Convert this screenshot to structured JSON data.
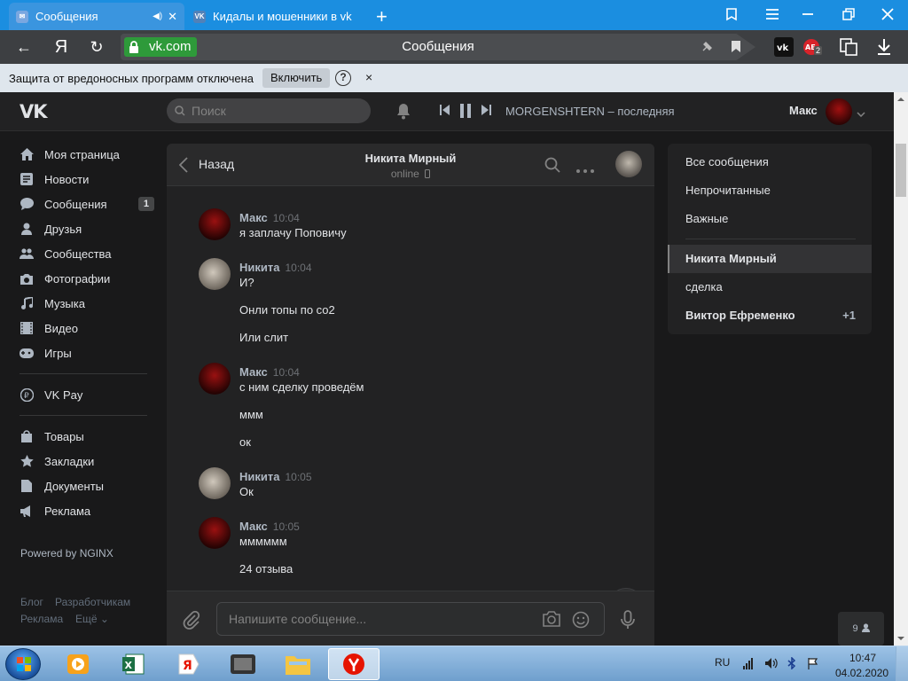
{
  "browser": {
    "tabs": [
      {
        "title": "Сообщения",
        "active": true
      },
      {
        "title": "Кидалы и мошенники в vk",
        "active": false
      }
    ],
    "new_tab": "+",
    "address": {
      "domain": "vk.com",
      "page_title": "Сообщения"
    },
    "nav": {
      "back": "←",
      "yandex": "Я",
      "reload": "↻"
    },
    "extensions": [
      "vk-extension-icon",
      "adblock-extension-icon",
      "screenshot-extension-icon",
      "download-icon"
    ],
    "adblock_badge": "2"
  },
  "protection_bar": {
    "message": "Защита от вредоносных программ отключена",
    "enable_button": "Включить",
    "help": "?",
    "close": "×"
  },
  "vk_header": {
    "logo": "VK",
    "search_placeholder": "Поиск",
    "player": {
      "track": "MORGENSHTERN – последняя"
    },
    "user_name": "Макс"
  },
  "left_nav": {
    "items": [
      {
        "label": "Моя страница",
        "icon": "home-icon"
      },
      {
        "label": "Новости",
        "icon": "news-icon"
      },
      {
        "label": "Сообщения",
        "icon": "messages-icon",
        "badge": "1"
      },
      {
        "label": "Друзья",
        "icon": "friends-icon"
      },
      {
        "label": "Сообщества",
        "icon": "communities-icon"
      },
      {
        "label": "Фотографии",
        "icon": "camera-icon"
      },
      {
        "label": "Музыка",
        "icon": "music-icon"
      },
      {
        "label": "Видео",
        "icon": "video-icon"
      },
      {
        "label": "Игры",
        "icon": "games-icon"
      },
      {
        "label": "VK Pay",
        "icon": "vkpay-icon"
      },
      {
        "label": "Товары",
        "icon": "goods-icon"
      },
      {
        "label": "Закладки",
        "icon": "bookmarks-icon"
      },
      {
        "label": "Документы",
        "icon": "documents-icon"
      },
      {
        "label": "Реклама",
        "icon": "ads-icon"
      }
    ],
    "powered": "Powered by NGINX",
    "footer": {
      "blog": "Блог",
      "developers": "Разработчикам",
      "ads": "Реклама",
      "more": "Ещё ⌄"
    }
  },
  "chat": {
    "back_label": "Назад",
    "peer_name": "Никита Мирный",
    "peer_status": "online",
    "messages": [
      {
        "author": "Макс",
        "time": "10:04",
        "lines": [
          "я заплачу Поповичу"
        ]
      },
      {
        "author": "Никита",
        "time": "10:04",
        "lines": [
          "И?",
          "Онли топы по со2",
          "Или слит"
        ]
      },
      {
        "author": "Макс",
        "time": "10:04",
        "lines": [
          "с ним сделку проведём",
          "ммм",
          "ок"
        ]
      },
      {
        "author": "Никита",
        "time": "10:05",
        "lines": [
          "Ок"
        ]
      },
      {
        "author": "Макс",
        "time": "10:05",
        "lines": [
          "мммммм",
          "24 отзыва"
        ]
      }
    ],
    "input_placeholder": "Напишите сообщение..."
  },
  "right_menu": {
    "items": [
      {
        "label": "Все сообщения"
      },
      {
        "label": "Непрочитанные"
      },
      {
        "label": "Важные"
      }
    ],
    "conversations": [
      {
        "label": "Никита Мирный",
        "selected": true
      },
      {
        "label": "сделка"
      },
      {
        "label": "Виктор Ефременко",
        "count": "+1"
      }
    ],
    "online_count": "9"
  },
  "taskbar": {
    "apps": [
      "media-player-icon",
      "excel-icon",
      "yandex-icon",
      "video-app-icon",
      "folder-icon",
      "yandex-browser-icon"
    ],
    "lang": "RU",
    "time": "10:47",
    "date": "04.02.2020"
  },
  "colors": {
    "vk_bg": "#19191a",
    "panel_bg": "#222223",
    "browser_tabs": "#1b8ee0",
    "address_bar": "#3d3f42",
    "secure_green": "#2e9a3a",
    "text_primary": "#e1e3e6",
    "text_secondary": "#aeb7c2"
  }
}
